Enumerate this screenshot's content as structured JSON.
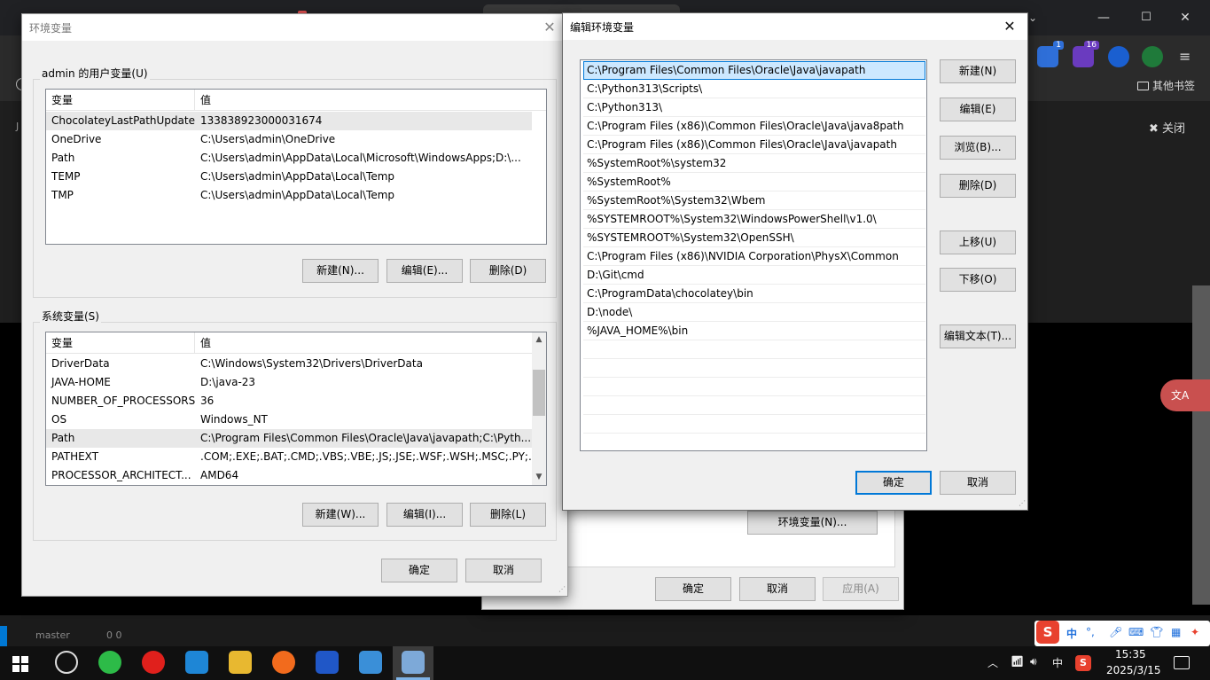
{
  "browser": {
    "bookmarks_label": "其他书签",
    "close_label": "关闭",
    "side_letter": "J",
    "badges": [
      "1",
      "16"
    ],
    "translate_label": "文A",
    "status_bar": [
      "master",
      "0  0"
    ]
  },
  "env_dialog": {
    "title": "环境变量",
    "user_group_label": "admin 的用户变量(U)",
    "header_var": "变量",
    "header_val": "值",
    "user_vars": [
      {
        "name": "ChocolateyLastPathUpdate",
        "value": "133838923000031674"
      },
      {
        "name": "OneDrive",
        "value": "C:\\Users\\admin\\OneDrive"
      },
      {
        "name": "Path",
        "value": "C:\\Users\\admin\\AppData\\Local\\Microsoft\\WindowsApps;D:\\..."
      },
      {
        "name": "TEMP",
        "value": "C:\\Users\\admin\\AppData\\Local\\Temp"
      },
      {
        "name": "TMP",
        "value": "C:\\Users\\admin\\AppData\\Local\\Temp"
      }
    ],
    "user_buttons": {
      "new": "新建(N)...",
      "edit": "编辑(E)...",
      "delete": "删除(D)"
    },
    "system_group_label": "系统变量(S)",
    "system_vars": [
      {
        "name": "DriverData",
        "value": "C:\\Windows\\System32\\Drivers\\DriverData"
      },
      {
        "name": "JAVA-HOME",
        "value": "D:\\java-23"
      },
      {
        "name": "NUMBER_OF_PROCESSORS",
        "value": "36"
      },
      {
        "name": "OS",
        "value": "Windows_NT"
      },
      {
        "name": "Path",
        "value": "C:\\Program Files\\Common Files\\Oracle\\Java\\javapath;C:\\Pyth..."
      },
      {
        "name": "PATHEXT",
        "value": ".COM;.EXE;.BAT;.CMD;.VBS;.VBE;.JS;.JSE;.WSF;.WSH;.MSC;.PY;.P..."
      },
      {
        "name": "PROCESSOR_ARCHITECT...",
        "value": "AMD64"
      }
    ],
    "system_buttons": {
      "new": "新建(W)...",
      "edit": "编辑(I)...",
      "delete": "删除(L)"
    },
    "ok": "确定",
    "cancel": "取消"
  },
  "sysprop_dialog": {
    "env_button": "环境变量(N)...",
    "ok": "确定",
    "cancel": "取消",
    "apply": "应用(A)"
  },
  "edit_dialog": {
    "title": "编辑环境变量",
    "paths": [
      "C:\\Program Files\\Common Files\\Oracle\\Java\\javapath",
      "C:\\Python313\\Scripts\\",
      "C:\\Python313\\",
      "C:\\Program Files (x86)\\Common Files\\Oracle\\Java\\java8path",
      "C:\\Program Files (x86)\\Common Files\\Oracle\\Java\\javapath",
      "%SystemRoot%\\system32",
      "%SystemRoot%",
      "%SystemRoot%\\System32\\Wbem",
      "%SYSTEMROOT%\\System32\\WindowsPowerShell\\v1.0\\",
      "%SYSTEMROOT%\\System32\\OpenSSH\\",
      "C:\\Program Files (x86)\\NVIDIA Corporation\\PhysX\\Common",
      "D:\\Git\\cmd",
      "C:\\ProgramData\\chocolatey\\bin",
      "D:\\node\\",
      "%JAVA_HOME%\\bin"
    ],
    "buttons": {
      "new": "新建(N)",
      "edit": "编辑(E)",
      "browse": "浏览(B)...",
      "delete": "删除(D)",
      "move_up": "上移(U)",
      "move_down": "下移(O)",
      "edit_text": "编辑文本(T)..."
    },
    "ok": "确定",
    "cancel": "取消"
  },
  "taskbar": {
    "apps": [
      "qq-icon",
      "wechat-icon",
      "iqiyi-icon",
      "vscode-icon",
      "file-explorer-icon",
      "firefox-icon",
      "pycharm-icon",
      "control-panel-icon",
      "system-properties-icon"
    ],
    "time": "15:35",
    "date": "2025/3/15",
    "ime_label": "中",
    "ime_bar_label": "中"
  },
  "colors": {
    "selection": "#cce8ff",
    "selection_strong": "#0078d7",
    "accent": "#0078d4"
  }
}
